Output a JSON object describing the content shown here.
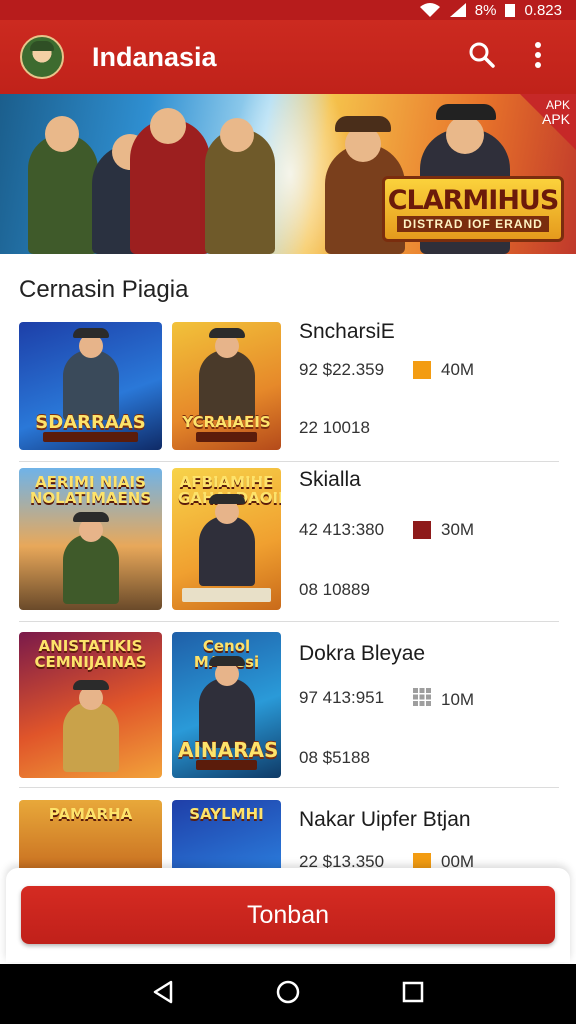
{
  "status_bar": {
    "time": "0.823",
    "battery_text": "8%"
  },
  "app_bar": {
    "title": "Indanasia"
  },
  "banner": {
    "logo_line1": "CLARMIHUS",
    "logo_line2": "DISTRAD IOF ERAND",
    "corner_small": "APK",
    "corner_big": "APK"
  },
  "section": {
    "title": "Cernasin Piagia"
  },
  "games": [
    {
      "name": "SncharsiE",
      "stat1": "92  $22.359",
      "size": "40M",
      "stat2": "22  10018",
      "thumb_a_title": "SDARRAAS",
      "thumb_b_title": "YCRAIAEIS",
      "thumb_b_top": "",
      "thumb_a_top": "",
      "size_color": "#f39c12"
    },
    {
      "name": "Skialla",
      "stat1": "42  413:380",
      "size": "30M",
      "stat2": "08  10889",
      "thumb_a_title": "",
      "thumb_a_top": "AERIMI NIAIS NOLATIMAENS",
      "thumb_b_title": "",
      "thumb_b_top": "AFBIAMIHE GAHALDAOIIS",
      "size_color": "#8e1b1b"
    },
    {
      "name": "Dokra Bleyae",
      "stat1": "97  413:951",
      "size": "10M",
      "stat2": "08  $5188",
      "thumb_a_title": "",
      "thumb_a_top": "ANISTATIKIS CEMNIJAINAS",
      "thumb_b_title": "AINARAS",
      "thumb_b_top": "Cenol MAIsesi",
      "size_color": "#9e9e9e"
    },
    {
      "name": "Nakar Uipfer Btjan",
      "stat1": "22  $13.350",
      "size": "00M",
      "stat2": "",
      "thumb_a_title": "",
      "thumb_a_top": "PAMARHA",
      "thumb_b_title": "",
      "thumb_b_top": "SAYLMHI",
      "size_color": "#f39c12"
    }
  ],
  "bottom_button": {
    "label": "Tonban"
  }
}
